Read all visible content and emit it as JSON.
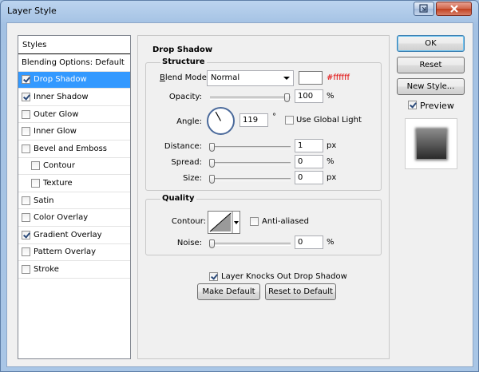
{
  "window": {
    "title": "Layer Style",
    "help_icon": "help-icon",
    "close_icon": "close-icon"
  },
  "styles_panel": {
    "header": "Styles",
    "items": [
      {
        "label": "Blending Options: Default",
        "checkbox": false,
        "checked": false,
        "indent": false,
        "selected": false
      },
      {
        "label": "Drop Shadow",
        "checkbox": true,
        "checked": true,
        "indent": false,
        "selected": true
      },
      {
        "label": "Inner Shadow",
        "checkbox": true,
        "checked": true,
        "indent": false,
        "selected": false
      },
      {
        "label": "Outer Glow",
        "checkbox": true,
        "checked": false,
        "indent": false,
        "selected": false
      },
      {
        "label": "Inner Glow",
        "checkbox": true,
        "checked": false,
        "indent": false,
        "selected": false
      },
      {
        "label": "Bevel and Emboss",
        "checkbox": true,
        "checked": false,
        "indent": false,
        "selected": false
      },
      {
        "label": "Contour",
        "checkbox": true,
        "checked": false,
        "indent": true,
        "selected": false
      },
      {
        "label": "Texture",
        "checkbox": true,
        "checked": false,
        "indent": true,
        "selected": false
      },
      {
        "label": "Satin",
        "checkbox": true,
        "checked": false,
        "indent": false,
        "selected": false
      },
      {
        "label": "Color Overlay",
        "checkbox": true,
        "checked": false,
        "indent": false,
        "selected": false
      },
      {
        "label": "Gradient Overlay",
        "checkbox": true,
        "checked": true,
        "indent": false,
        "selected": false
      },
      {
        "label": "Pattern Overlay",
        "checkbox": true,
        "checked": false,
        "indent": false,
        "selected": false
      },
      {
        "label": "Stroke",
        "checkbox": true,
        "checked": false,
        "indent": false,
        "selected": false
      }
    ]
  },
  "drop_shadow": {
    "title": "Drop Shadow",
    "structure": {
      "title": "Structure",
      "blend_mode_label": "Blend Mode:",
      "blend_mode_value": "Normal",
      "color_hex": "#ffffff",
      "color_value": "#ffffff",
      "opacity_label": "Opacity:",
      "opacity_value": "100",
      "opacity_unit": "%",
      "opacity_fraction": 1.0,
      "angle_label": "Angle:",
      "angle_value": "119",
      "angle_degrees": 119,
      "angle_unit": "°",
      "use_global_light_label": "Use Global Light",
      "use_global_light_checked": false,
      "distance_label": "Distance:",
      "distance_value": "1",
      "distance_unit": "px",
      "distance_fraction": 0.0,
      "spread_label": "Spread:",
      "spread_value": "0",
      "spread_unit": "%",
      "spread_fraction": 0.0,
      "size_label": "Size:",
      "size_value": "0",
      "size_unit": "px",
      "size_fraction": 0.0
    },
    "quality": {
      "title": "Quality",
      "contour_label": "Contour:",
      "anti_aliased_label": "Anti-aliased",
      "anti_aliased_checked": false,
      "noise_label": "Noise:",
      "noise_value": "0",
      "noise_unit": "%",
      "noise_fraction": 0.0
    },
    "knocks_out_label": "Layer Knocks Out Drop Shadow",
    "knocks_out_checked": true,
    "make_default_label": "Make Default",
    "reset_default_label": "Reset to Default"
  },
  "actions": {
    "ok_label": "OK",
    "reset_label": "Reset",
    "new_style_label": "New Style...",
    "preview_label": "Preview",
    "preview_checked": true
  },
  "colors": {
    "selection": "#3399ff",
    "hex_text": "#e00000",
    "title_gradient": "#a9c6e6"
  }
}
